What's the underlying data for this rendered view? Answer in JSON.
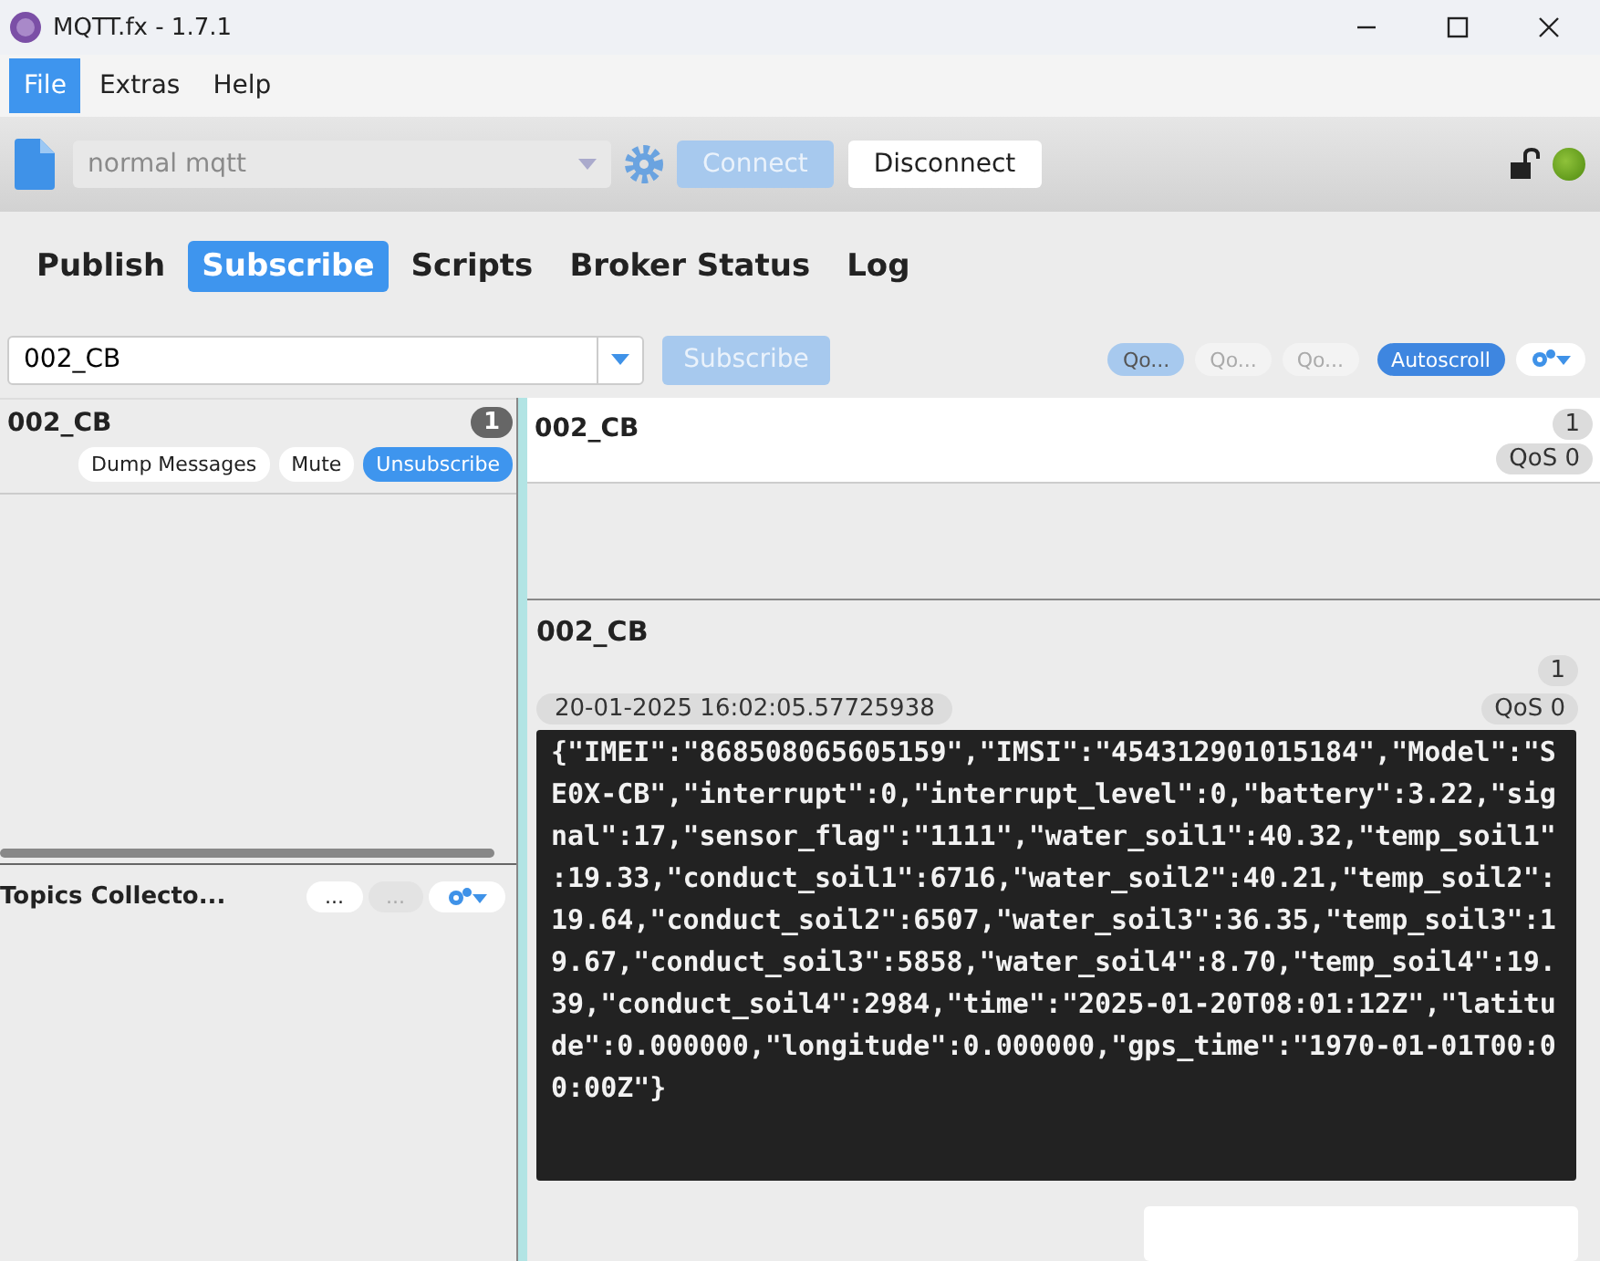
{
  "window": {
    "title": "MQTT.fx - 1.7.1"
  },
  "menu": [
    {
      "label": "File",
      "selected": true
    },
    {
      "label": "Extras",
      "selected": false
    },
    {
      "label": "Help",
      "selected": false
    }
  ],
  "toolbar": {
    "profile": "normal mqtt",
    "connect": {
      "label": "Connect",
      "disabled": true
    },
    "disconnect": {
      "label": "Disconnect",
      "disabled": false
    },
    "connected": true
  },
  "tabs": [
    {
      "label": "Publish",
      "selected": false
    },
    {
      "label": "Subscribe",
      "selected": true
    },
    {
      "label": "Scripts",
      "selected": false
    },
    {
      "label": "Broker Status",
      "selected": false
    },
    {
      "label": "Log",
      "selected": false
    }
  ],
  "subscribe_bar": {
    "topic": "002_CB",
    "button": {
      "label": "Subscribe",
      "disabled": true
    },
    "qos": [
      {
        "label": "Qo...",
        "selected": true
      },
      {
        "label": "Qo...",
        "selected": false
      },
      {
        "label": "Qo...",
        "selected": false
      }
    ],
    "autoscroll": {
      "label": "Autoscroll",
      "on": true
    }
  },
  "subscriptions": [
    {
      "topic": "002_CB",
      "count": "1",
      "buttons": [
        "Dump Messages",
        "Mute",
        "Unsubscribe"
      ]
    }
  ],
  "topics_collector": {
    "title": "Topics Collecto...",
    "buttons": [
      {
        "label": "...",
        "disabled": false
      },
      {
        "label": "...",
        "disabled": true
      }
    ]
  },
  "messages": [
    {
      "topic": "002_CB",
      "count": "1",
      "qos": "QoS 0"
    }
  ],
  "detail": {
    "topic": "002_CB",
    "count": "1",
    "timestamp": "20-01-2025  16:02:05.57725938",
    "qos": "QoS 0",
    "payload": "{\"IMEI\":\"868508065605159\",\"IMSI\":\"454312901015184\",\"Model\":\"SE0X-CB\",\"interrupt\":0,\"interrupt_level\":0,\"battery\":3.22,\"signal\":17,\"sensor_flag\":\"1111\",\"water_soil1\":40.32,\"temp_soil1\":19.33,\"conduct_soil1\":6716,\"water_soil2\":40.21,\"temp_soil2\":19.64,\"conduct_soil2\":6507,\"water_soil3\":36.35,\"temp_soil3\":19.67,\"conduct_soil3\":5858,\"water_soil4\":8.70,\"temp_soil4\":19.39,\"conduct_soil4\":2984,\"time\":\"2025-01-20T08:01:12Z\",\"latitude\":0.000000,\"longitude\":0.000000,\"gps_time\":\"1970-01-01T00:00:00Z\"}"
  }
}
